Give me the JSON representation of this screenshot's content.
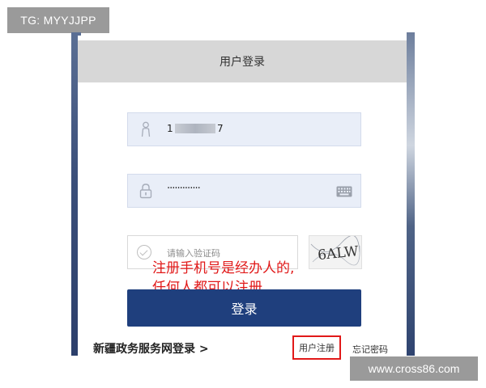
{
  "watermark_top_left": "TG: MYYJJPP",
  "watermark_bottom_right": "www.cross86.com",
  "login_card": {
    "title": "用户登录",
    "username_value": "1",
    "username_suffix": "7",
    "password_value": "·············",
    "captcha_placeholder": "请输入验证码",
    "captcha_text": "6ALW",
    "login_button": "登录",
    "gov_service_link": "新疆政务服务网登录 >",
    "register_link": "用户注册",
    "forgot_password_link": "忘记密码"
  },
  "annotation": {
    "line1": "注册手机号是经办人的,",
    "line2": "任何人都可以注册"
  },
  "colors": {
    "primary": "#1f3f7d",
    "header_bg": "#d7d7d7",
    "field_bg": "#e9eef8",
    "annotation_red": "#e11919"
  }
}
